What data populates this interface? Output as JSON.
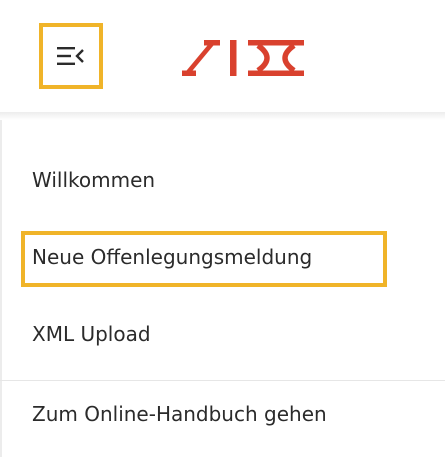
{
  "header": {
    "menu_icon": "menu-collapse-icon",
    "logo_text": "SIX",
    "brand_color": "#d9412e",
    "highlight_color": "#f0b429"
  },
  "nav": {
    "items": [
      {
        "label": "Willkommen"
      },
      {
        "label": "Neue Offenlegungsmeldung",
        "highlighted": true
      },
      {
        "label": "XML Upload"
      },
      {
        "label": "Zum Online-Handbuch gehen"
      }
    ]
  }
}
